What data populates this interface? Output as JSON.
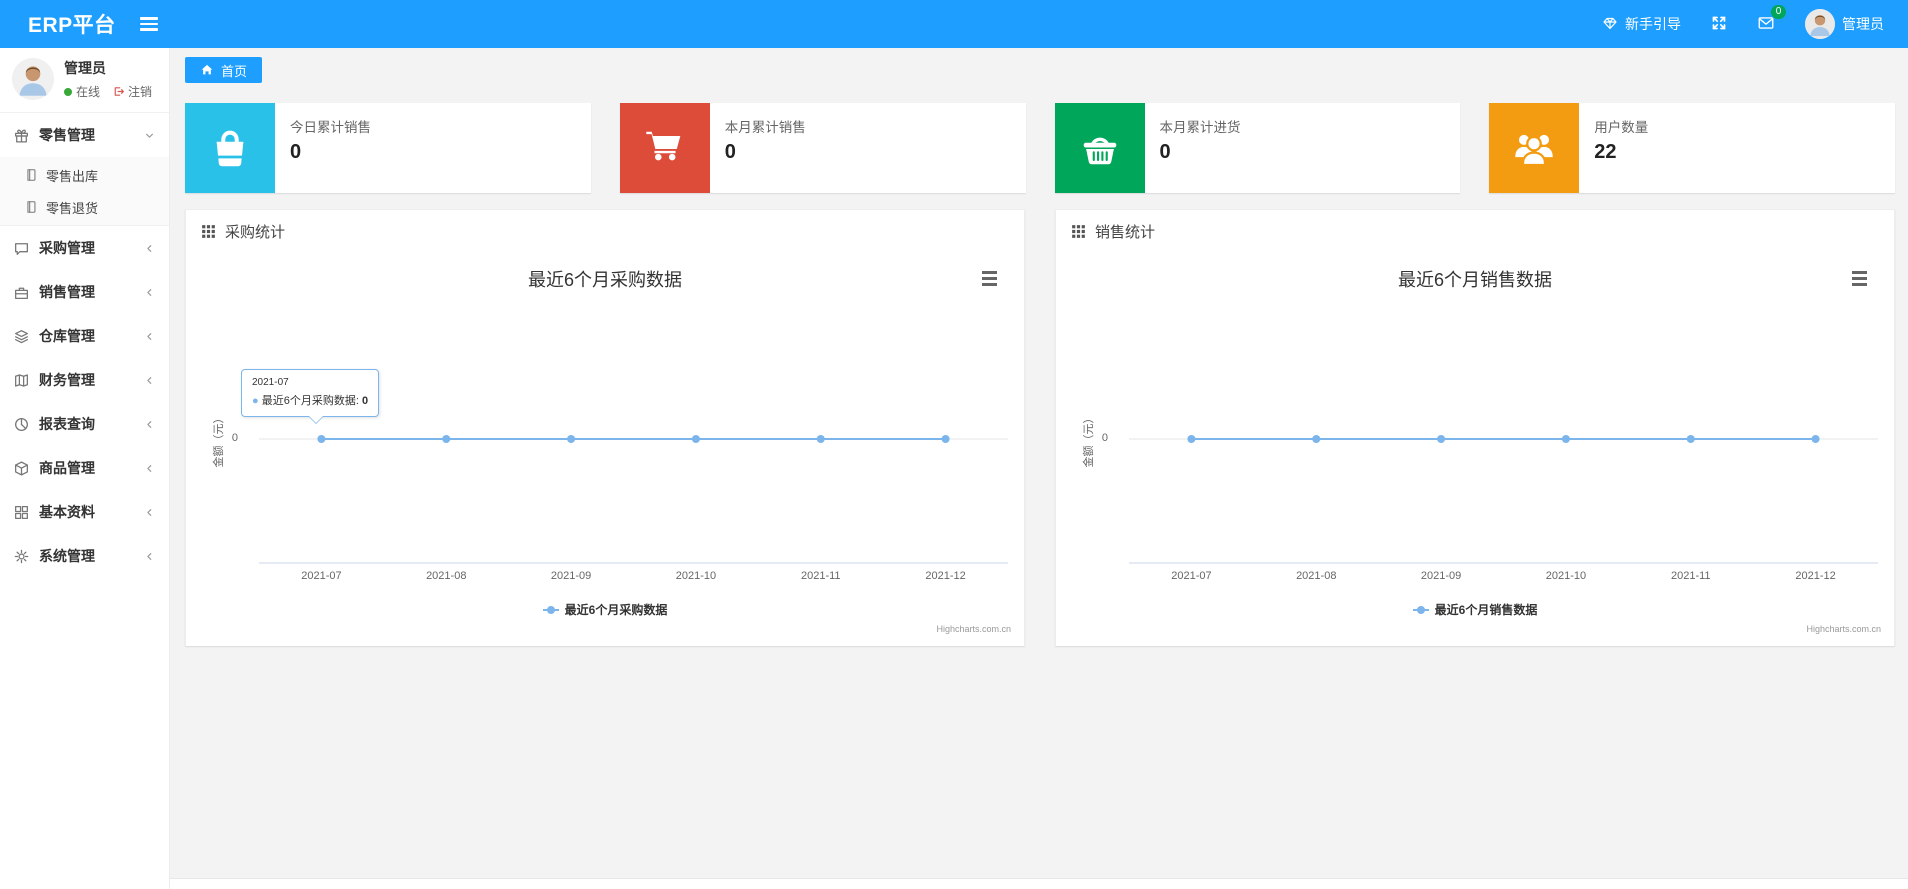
{
  "navbar": {
    "brand": "ERP平台",
    "guide_label": "新手引导",
    "message_badge": "0",
    "user_name": "管理员"
  },
  "sidebar": {
    "user": {
      "name": "管理员",
      "status_online": "在线",
      "logout_label": "注销"
    },
    "menu": [
      {
        "label": "零售管理",
        "icon": "gift-icon",
        "state": "expanded",
        "children": [
          {
            "label": "零售出库",
            "icon": "file-icon"
          },
          {
            "label": "零售退货",
            "icon": "file-icon"
          }
        ]
      },
      {
        "label": "采购管理",
        "icon": "chat-icon",
        "state": "collapsed"
      },
      {
        "label": "销售管理",
        "icon": "briefcase-icon",
        "state": "collapsed"
      },
      {
        "label": "仓库管理",
        "icon": "layers-icon",
        "state": "collapsed"
      },
      {
        "label": "财务管理",
        "icon": "map-icon",
        "state": "collapsed"
      },
      {
        "label": "报表查询",
        "icon": "pie-chart-icon",
        "state": "collapsed"
      },
      {
        "label": "商品管理",
        "icon": "cube-icon",
        "state": "collapsed"
      },
      {
        "label": "基本资料",
        "icon": "grid-icon",
        "state": "collapsed"
      },
      {
        "label": "系统管理",
        "icon": "gear-icon",
        "state": "collapsed"
      }
    ]
  },
  "breadcrumb": {
    "home": "首页"
  },
  "stat_cards": [
    {
      "label": "今日累计销售",
      "value": "0",
      "color": "#29c1e8",
      "icon": "shopping-bag-icon"
    },
    {
      "label": "本月累计销售",
      "value": "0",
      "color": "#dd4b39",
      "icon": "cart-icon"
    },
    {
      "label": "本月累计进货",
      "value": "0",
      "color": "#00a65a",
      "icon": "basket-icon"
    },
    {
      "label": "用户数量",
      "value": "22",
      "color": "#f39c12",
      "icon": "users-icon"
    }
  ],
  "chart_data": [
    {
      "type": "line",
      "panel_title": "采购统计",
      "title": "最近6个月采购数据",
      "categories": [
        "2021-07",
        "2021-08",
        "2021-09",
        "2021-10",
        "2021-11",
        "2021-12"
      ],
      "series": [
        {
          "name": "最近6个月采购数据",
          "values": [
            0,
            0,
            0,
            0,
            0,
            0
          ]
        }
      ],
      "ylabel": "金额（元）",
      "yticks": [
        "0"
      ],
      "ylim": [
        -1,
        1
      ],
      "grid": true,
      "legend_position": "bottom",
      "line_color": "#7cb5ec",
      "credit": "Highcharts.com.cn",
      "tooltip": {
        "header": "2021-07",
        "series": "最近6个月采购数据",
        "value": "0"
      }
    },
    {
      "type": "line",
      "panel_title": "销售统计",
      "title": "最近6个月销售数据",
      "categories": [
        "2021-07",
        "2021-08",
        "2021-09",
        "2021-10",
        "2021-11",
        "2021-12"
      ],
      "series": [
        {
          "name": "最近6个月销售数据",
          "values": [
            0,
            0,
            0,
            0,
            0,
            0
          ]
        }
      ],
      "ylabel": "金额（元）",
      "yticks": [
        "0"
      ],
      "ylim": [
        -1,
        1
      ],
      "grid": true,
      "legend_position": "bottom",
      "line_color": "#7cb5ec",
      "credit": "Highcharts.com.cn",
      "tooltip": null
    }
  ]
}
